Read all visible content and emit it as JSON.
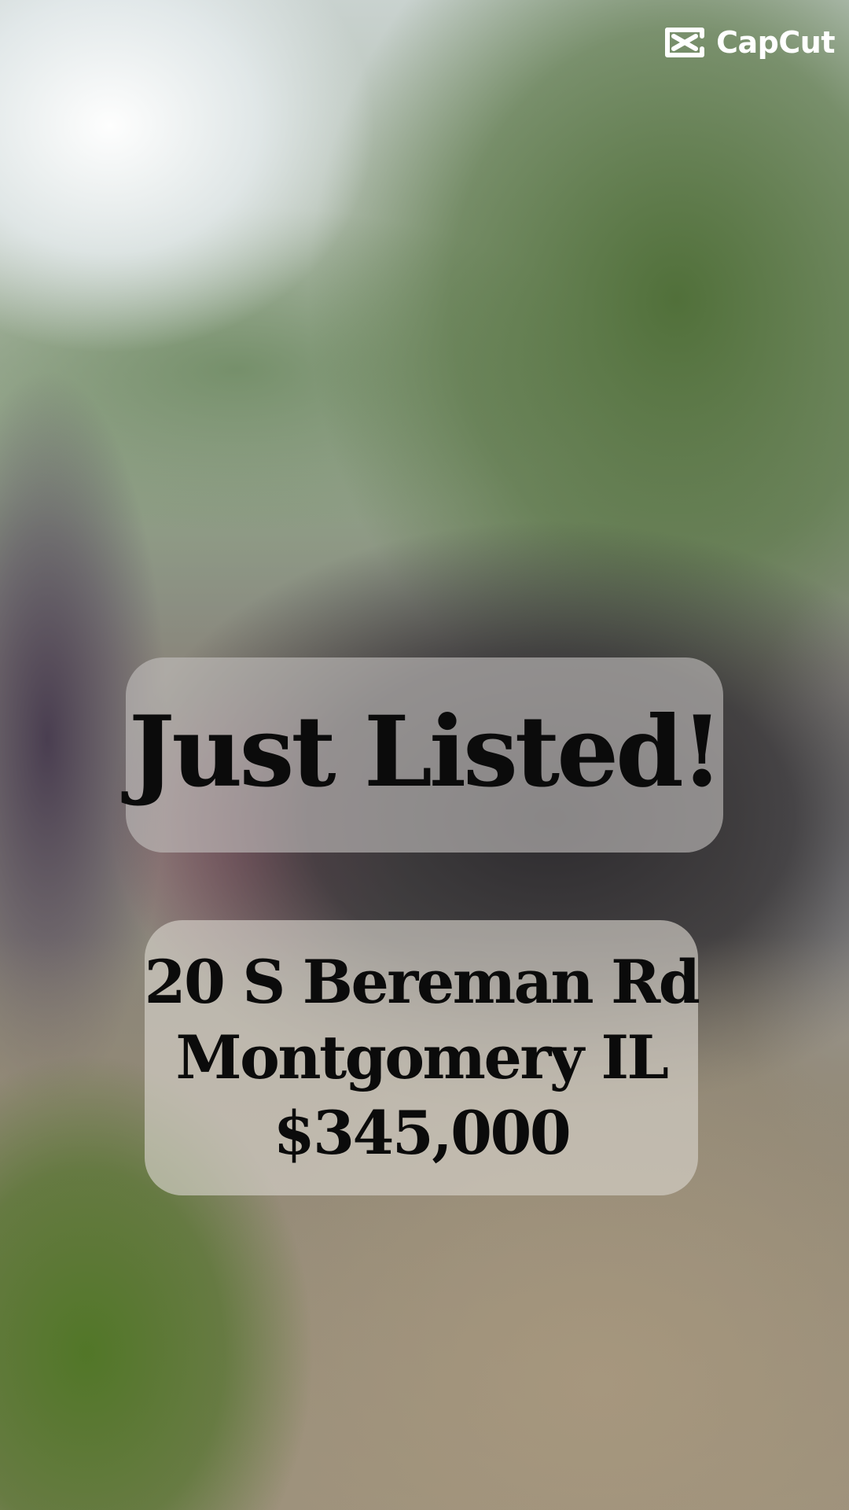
{
  "brand": {
    "name": "CapCut",
    "icon": "capcut-logo-icon"
  },
  "listing": {
    "headline": "Just Listed!",
    "address_line": "20 S Bereman Rd",
    "city_line": "Montgomery IL",
    "price": "$345,000"
  },
  "colors": {
    "text": "#0b0b0b",
    "brand_text": "#ffffff"
  }
}
